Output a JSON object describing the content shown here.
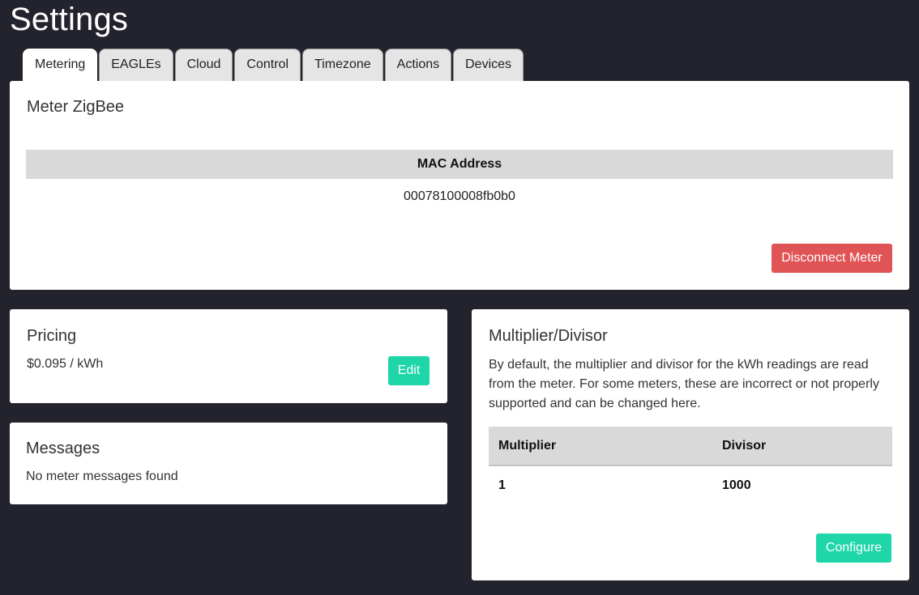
{
  "page": {
    "title": "Settings"
  },
  "tabs": [
    {
      "label": "Metering",
      "active": true
    },
    {
      "label": "EAGLEs"
    },
    {
      "label": "Cloud"
    },
    {
      "label": "Control"
    },
    {
      "label": "Timezone"
    },
    {
      "label": "Actions"
    },
    {
      "label": "Devices"
    }
  ],
  "meter": {
    "title": "Meter ZigBee",
    "mac_header": "MAC Address",
    "mac_value": "00078100008fb0b0",
    "disconnect_label": "Disconnect Meter"
  },
  "pricing": {
    "title": "Pricing",
    "price": "$0.095 / kWh",
    "edit_label": "Edit"
  },
  "messages": {
    "title": "Messages",
    "text": "No meter messages found"
  },
  "multiplier": {
    "title": "Multiplier/Divisor",
    "description": "By default, the multiplier and divisor for the kWh readings are read from the meter. For some meters, these are incorrect or not properly supported and can be changed here.",
    "col_multiplier": "Multiplier",
    "col_divisor": "Divisor",
    "multiplier_value": "1",
    "divisor_value": "1000",
    "configure_label": "Configure"
  },
  "colors": {
    "background": "#23232d",
    "danger": "#e05455",
    "accent": "#1fd6a9"
  }
}
